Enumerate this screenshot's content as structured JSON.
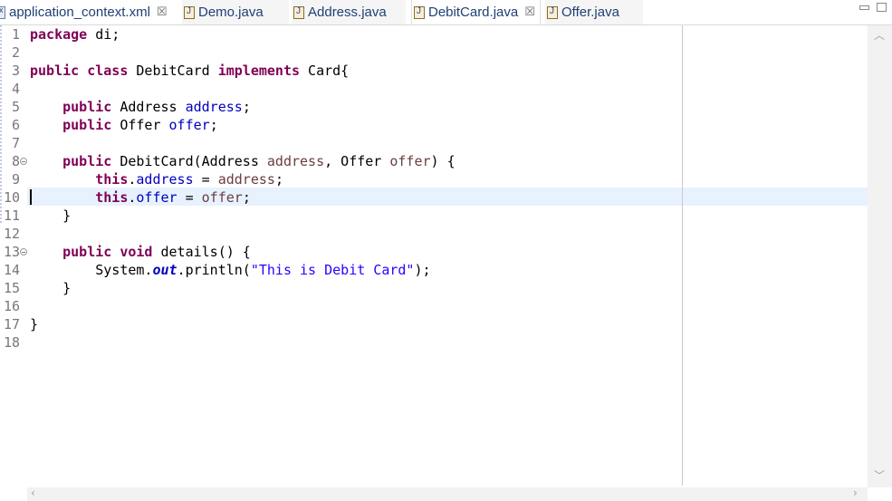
{
  "tabs": [
    {
      "label": "application_context.xml",
      "icon": "xml-file-icon",
      "closable": true,
      "active": false
    },
    {
      "label": "Demo.java",
      "icon": "java-file-icon",
      "closable": false,
      "active": false
    },
    {
      "label": "Address.java",
      "icon": "java-file-icon",
      "closable": false,
      "active": false
    },
    {
      "label": "DebitCard.java",
      "icon": "java-file-icon",
      "closable": true,
      "active": true
    },
    {
      "label": "Offer.java",
      "icon": "java-file-icon",
      "closable": false,
      "active": false
    }
  ],
  "close_glyph": "☒",
  "line_numbers": [
    "1",
    "2",
    "3",
    "4",
    "5",
    "6",
    "7",
    "8",
    "9",
    "10",
    "11",
    "12",
    "13",
    "14",
    "15",
    "16",
    "17",
    "18"
  ],
  "code": {
    "l1_kw": "package",
    "l1_rest": " di;",
    "l3_kw1": "public",
    "l3_kw2": "class",
    "l3_name": " DebitCard ",
    "l3_kw3": "implements",
    "l3_rest": " Card{",
    "l5_kw": "public",
    "l5_type": " Address ",
    "l5_field": "address",
    "l5_end": ";",
    "l6_kw": "public",
    "l6_type": " Offer ",
    "l6_field": "offer",
    "l6_end": ";",
    "l8_kw": "public",
    "l8_a": " DebitCard(Address ",
    "l8_p1": "address",
    "l8_b": ", Offer ",
    "l8_p2": "offer",
    "l8_c": ") {",
    "l9_kw": "this",
    "l9_dot": ".",
    "l9_field": "address",
    "l9_eq": " = ",
    "l9_param": "address",
    "l9_end": ";",
    "l10_kw": "this",
    "l10_dot": ".",
    "l10_field": "offer",
    "l10_eq": " = ",
    "l10_param": "offer",
    "l10_end": ";",
    "l11": "}",
    "l13_kw1": "public",
    "l13_kw2": "void",
    "l13_rest": " details() {",
    "l14_a": "System.",
    "l14_out": "out",
    "l14_b": ".println(",
    "l14_str": "\"This is Debit Card\"",
    "l14_c": ");",
    "l15": "}",
    "l17": "}"
  },
  "colors": {
    "keyword": "#7f0055",
    "field": "#0000c0",
    "parameter": "#6a3e3e",
    "string": "#2a00ff",
    "current_line": "#e8f2fe"
  }
}
